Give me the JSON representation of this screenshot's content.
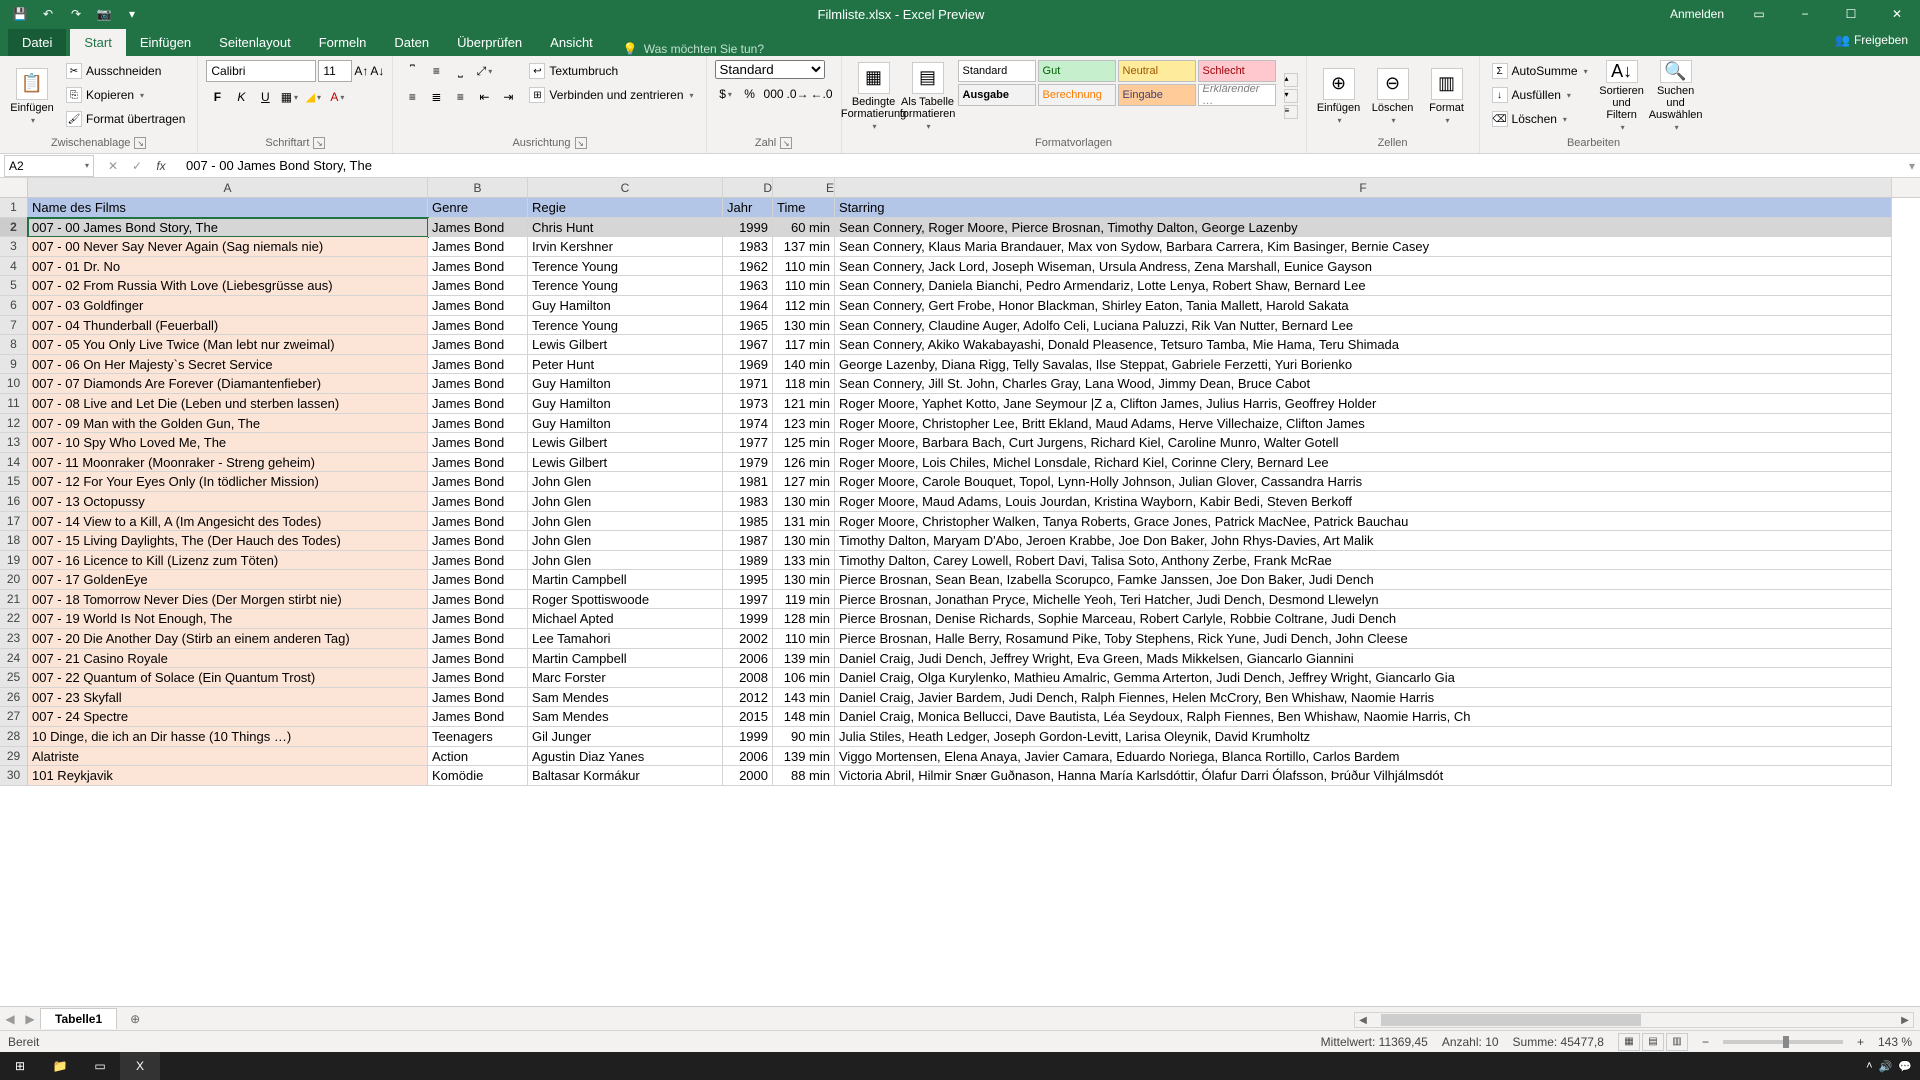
{
  "titlebar": {
    "title": "Filmliste.xlsx  -  Excel Preview",
    "anmelden": "Anmelden"
  },
  "tabs": {
    "datei": "Datei",
    "start": "Start",
    "einfuegen": "Einfügen",
    "seitenlayout": "Seitenlayout",
    "formeln": "Formeln",
    "daten": "Daten",
    "ueberpruefen": "Überprüfen",
    "ansicht": "Ansicht",
    "tellme": "Was möchten Sie tun?",
    "freigeben": "Freigeben"
  },
  "ribbon": {
    "clipboard": {
      "label": "Zwischenablage",
      "einfuegen": "Einfügen",
      "ausschneiden": "Ausschneiden",
      "kopieren": "Kopieren",
      "format": "Format übertragen"
    },
    "font": {
      "label": "Schriftart",
      "name": "Calibri",
      "size": "11"
    },
    "alignment": {
      "label": "Ausrichtung",
      "wrap": "Textumbruch",
      "merge": "Verbinden und zentrieren"
    },
    "number": {
      "label": "Zahl",
      "format": "Standard"
    },
    "styles": {
      "label": "Formatvorlagen",
      "bedingte": "Bedingte Formatierung",
      "als_tabelle": "Als Tabelle formatieren",
      "standard": "Standard",
      "gut": "Gut",
      "neutral": "Neutral",
      "schlecht": "Schlecht",
      "ausgabe": "Ausgabe",
      "berechnung": "Berechnung",
      "eingabe": "Eingabe",
      "erklaerender": "Erklärender …"
    },
    "cells": {
      "label": "Zellen",
      "einfuegen": "Einfügen",
      "loeschen": "Löschen",
      "format": "Format"
    },
    "editing": {
      "label": "Bearbeiten",
      "autosumme": "AutoSumme",
      "ausfuellen": "Ausfüllen",
      "loeschen": "Löschen",
      "sortieren": "Sortieren und Filtern",
      "suchen": "Suchen und Auswählen"
    }
  },
  "formula": {
    "cell_ref": "A2",
    "value": "007 - 00 James Bond Story, The"
  },
  "columns": [
    "A",
    "B",
    "C",
    "D",
    "E",
    "F"
  ],
  "headers": {
    "A": "Name des Films",
    "B": "Genre",
    "C": "Regie",
    "D": "Jahr",
    "E": "Time",
    "F": "Starring"
  },
  "rows": [
    {
      "n": 2,
      "A": "007 - 00 James Bond Story, The",
      "B": "James Bond",
      "C": "Chris Hunt",
      "D": "1999",
      "E": "60 min",
      "F": "Sean Connery, Roger Moore, Pierce Brosnan, Timothy Dalton, George Lazenby"
    },
    {
      "n": 3,
      "A": "007 - 00 Never Say Never Again (Sag niemals nie)",
      "B": "James Bond",
      "C": "Irvin Kershner",
      "D": "1983",
      "E": "137 min",
      "F": "Sean Connery, Klaus Maria Brandauer, Max von Sydow, Barbara Carrera, Kim Basinger, Bernie Casey"
    },
    {
      "n": 4,
      "A": "007 - 01 Dr. No",
      "B": "James Bond",
      "C": "Terence Young",
      "D": "1962",
      "E": "110 min",
      "F": "Sean Connery, Jack Lord, Joseph Wiseman, Ursula Andress, Zena Marshall, Eunice Gayson"
    },
    {
      "n": 5,
      "A": "007 - 02 From Russia With Love (Liebesgrüsse aus)",
      "B": "James Bond",
      "C": "Terence Young",
      "D": "1963",
      "E": "110 min",
      "F": "Sean Connery, Daniela Bianchi, Pedro Armendariz, Lotte Lenya, Robert Shaw, Bernard Lee"
    },
    {
      "n": 6,
      "A": "007 - 03 Goldfinger",
      "B": "James Bond",
      "C": "Guy Hamilton",
      "D": "1964",
      "E": "112 min",
      "F": "Sean Connery, Gert Frobe, Honor Blackman, Shirley Eaton, Tania Mallett, Harold Sakata"
    },
    {
      "n": 7,
      "A": "007 - 04 Thunderball (Feuerball)",
      "B": "James Bond",
      "C": "Terence Young",
      "D": "1965",
      "E": "130 min",
      "F": "Sean Connery, Claudine Auger, Adolfo Celi, Luciana Paluzzi, Rik Van Nutter, Bernard Lee"
    },
    {
      "n": 8,
      "A": "007 - 05 You Only Live Twice (Man lebt nur zweimal)",
      "B": "James Bond",
      "C": "Lewis Gilbert",
      "D": "1967",
      "E": "117 min",
      "F": "Sean Connery, Akiko Wakabayashi, Donald Pleasence, Tetsuro Tamba, Mie Hama, Teru Shimada"
    },
    {
      "n": 9,
      "A": "007 - 06 On Her Majesty`s Secret Service",
      "B": "James Bond",
      "C": "Peter Hunt",
      "D": "1969",
      "E": "140 min",
      "F": "George Lazenby, Diana Rigg, Telly Savalas, Ilse Steppat, Gabriele Ferzetti, Yuri Borienko"
    },
    {
      "n": 10,
      "A": "007 - 07 Diamonds Are Forever (Diamantenfieber)",
      "B": "James Bond",
      "C": "Guy Hamilton",
      "D": "1971",
      "E": "118 min",
      "F": "Sean Connery, Jill St. John, Charles Gray, Lana Wood, Jimmy Dean, Bruce Cabot"
    },
    {
      "n": 11,
      "A": "007 - 08 Live and Let Die (Leben und sterben lassen)",
      "B": "James Bond",
      "C": "Guy Hamilton",
      "D": "1973",
      "E": "121 min",
      "F": "Roger Moore, Yaphet Kotto, Jane Seymour |Z a, Clifton James, Julius Harris, Geoffrey Holder"
    },
    {
      "n": 12,
      "A": "007 - 09 Man with the Golden Gun, The",
      "B": "James Bond",
      "C": "Guy Hamilton",
      "D": "1974",
      "E": "123 min",
      "F": "Roger Moore, Christopher Lee, Britt Ekland, Maud Adams, Herve Villechaize, Clifton James"
    },
    {
      "n": 13,
      "A": "007 - 10 Spy Who Loved Me, The",
      "B": "James Bond",
      "C": "Lewis Gilbert",
      "D": "1977",
      "E": "125 min",
      "F": "Roger Moore, Barbara Bach, Curt Jurgens, Richard Kiel, Caroline Munro, Walter Gotell"
    },
    {
      "n": 14,
      "A": "007 - 11 Moonraker (Moonraker - Streng geheim)",
      "B": "James Bond",
      "C": "Lewis Gilbert",
      "D": "1979",
      "E": "126 min",
      "F": "Roger Moore, Lois Chiles, Michel Lonsdale, Richard Kiel, Corinne Clery, Bernard Lee"
    },
    {
      "n": 15,
      "A": "007 - 12 For Your Eyes Only (In tödlicher Mission)",
      "B": "James Bond",
      "C": "John Glen",
      "D": "1981",
      "E": "127 min",
      "F": "Roger Moore, Carole Bouquet, Topol, Lynn-Holly Johnson, Julian Glover, Cassandra Harris"
    },
    {
      "n": 16,
      "A": "007 - 13 Octopussy",
      "B": "James Bond",
      "C": "John Glen",
      "D": "1983",
      "E": "130 min",
      "F": "Roger Moore, Maud Adams, Louis Jourdan, Kristina Wayborn, Kabir Bedi, Steven Berkoff"
    },
    {
      "n": 17,
      "A": "007 - 14 View to a Kill, A (Im Angesicht des Todes)",
      "B": "James Bond",
      "C": "John Glen",
      "D": "1985",
      "E": "131 min",
      "F": "Roger Moore, Christopher Walken, Tanya Roberts, Grace Jones, Patrick MacNee, Patrick Bauchau"
    },
    {
      "n": 18,
      "A": "007 - 15 Living Daylights, The (Der Hauch des Todes)",
      "B": "James Bond",
      "C": "John Glen",
      "D": "1987",
      "E": "130 min",
      "F": "Timothy Dalton, Maryam D'Abo, Jeroen Krabbe, Joe Don Baker, John Rhys-Davies, Art Malik"
    },
    {
      "n": 19,
      "A": "007 - 16 Licence to Kill (Lizenz zum Töten)",
      "B": "James Bond",
      "C": "John Glen",
      "D": "1989",
      "E": "133 min",
      "F": "Timothy Dalton, Carey Lowell, Robert Davi, Talisa Soto, Anthony Zerbe, Frank McRae"
    },
    {
      "n": 20,
      "A": "007 - 17 GoldenEye",
      "B": "James Bond",
      "C": "Martin Campbell",
      "D": "1995",
      "E": "130 min",
      "F": "Pierce Brosnan, Sean Bean, Izabella Scorupco, Famke Janssen, Joe Don Baker, Judi Dench"
    },
    {
      "n": 21,
      "A": "007 - 18 Tomorrow Never Dies (Der Morgen stirbt nie)",
      "B": "James Bond",
      "C": "Roger Spottiswoode",
      "D": "1997",
      "E": "119 min",
      "F": "Pierce Brosnan, Jonathan Pryce, Michelle Yeoh, Teri Hatcher, Judi Dench, Desmond Llewelyn"
    },
    {
      "n": 22,
      "A": "007 - 19 World Is Not Enough, The",
      "B": "James Bond",
      "C": "Michael Apted",
      "D": "1999",
      "E": "128 min",
      "F": "Pierce Brosnan, Denise Richards, Sophie Marceau, Robert Carlyle, Robbie Coltrane, Judi Dench"
    },
    {
      "n": 23,
      "A": "007 - 20 Die Another Day (Stirb an einem anderen Tag)",
      "B": "James Bond",
      "C": "Lee Tamahori",
      "D": "2002",
      "E": "110 min",
      "F": "Pierce Brosnan, Halle Berry, Rosamund Pike, Toby Stephens, Rick Yune, Judi Dench, John Cleese"
    },
    {
      "n": 24,
      "A": "007 - 21 Casino Royale",
      "B": "James Bond",
      "C": "Martin Campbell",
      "D": "2006",
      "E": "139 min",
      "F": "Daniel Craig, Judi Dench, Jeffrey Wright, Eva Green, Mads Mikkelsen, Giancarlo Giannini"
    },
    {
      "n": 25,
      "A": "007 - 22 Quantum of Solace (Ein Quantum Trost)",
      "B": "James Bond",
      "C": "Marc Forster",
      "D": "2008",
      "E": "106 min",
      "F": "Daniel Craig, Olga Kurylenko, Mathieu Amalric, Gemma Arterton, Judi Dench, Jeffrey Wright, Giancarlo Gia"
    },
    {
      "n": 26,
      "A": "007 - 23 Skyfall",
      "B": "James Bond",
      "C": "Sam Mendes",
      "D": "2012",
      "E": "143 min",
      "F": "Daniel Craig, Javier Bardem, Judi Dench, Ralph Fiennes, Helen McCrory, Ben Whishaw, Naomie Harris"
    },
    {
      "n": 27,
      "A": "007 - 24 Spectre",
      "B": "James Bond",
      "C": "Sam Mendes",
      "D": "2015",
      "E": "148 min",
      "F": "Daniel Craig, Monica Bellucci, Dave Bautista, Léa Seydoux, Ralph Fiennes, Ben Whishaw, Naomie Harris, Ch"
    },
    {
      "n": 28,
      "A": "10 Dinge, die ich an Dir hasse (10 Things …)",
      "B": "Teenagers",
      "C": "Gil Junger",
      "D": "1999",
      "E": "90 min",
      "F": "Julia Stiles, Heath Ledger, Joseph Gordon-Levitt, Larisa Oleynik, David Krumholtz"
    },
    {
      "n": 29,
      "A": "Alatriste",
      "B": "Action",
      "C": "Agustin Diaz Yanes",
      "D": "2006",
      "E": "139 min",
      "F": "Viggo Mortensen, Elena Anaya, Javier Camara, Eduardo Noriega, Blanca Rortillo, Carlos Bardem"
    },
    {
      "n": 30,
      "A": "101 Reykjavik",
      "B": "Komödie",
      "C": "Baltasar Kormákur",
      "D": "2000",
      "E": "88 min",
      "F": "Victoria Abril, Hilmir Snær Guðnason, Hanna María Karlsdóttir, Ólafur Darri Ólafsson, Þrúður Vilhjálmsdót"
    }
  ],
  "sheet": {
    "name": "Tabelle1"
  },
  "status": {
    "ready": "Bereit",
    "mittelwert": "Mittelwert: 11369,45",
    "anzahl": "Anzahl: 10",
    "summe": "Summe: 45477,8",
    "zoom": "143 %"
  }
}
